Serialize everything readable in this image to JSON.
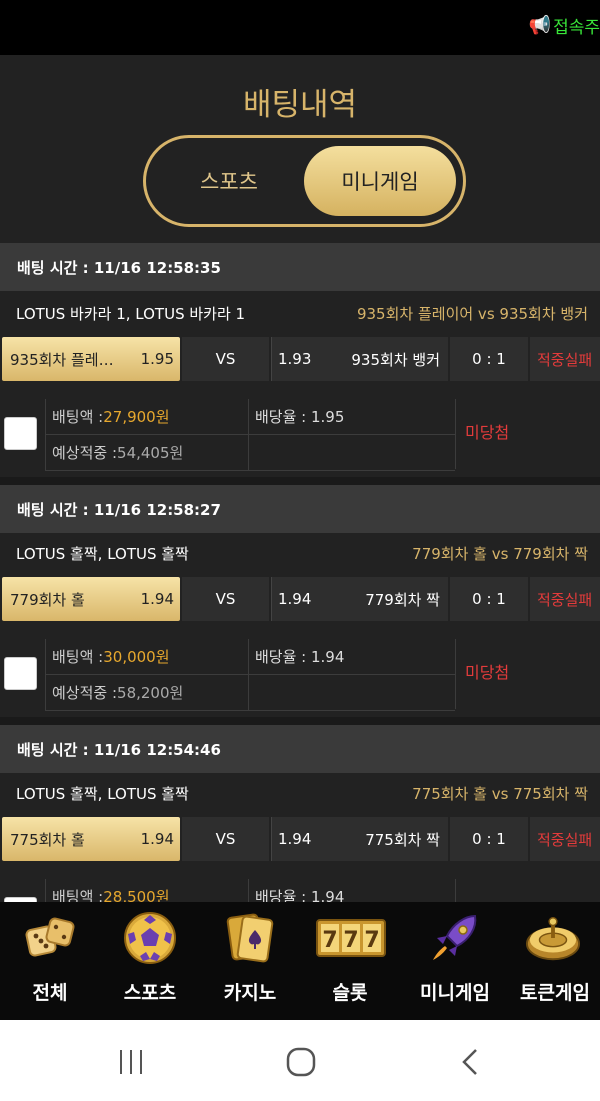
{
  "marquee": {
    "text": "접속주",
    "icon": "megaphone-icon"
  },
  "header": {
    "title": "배팅내역"
  },
  "tabs": [
    {
      "label": "스포츠",
      "active": false
    },
    {
      "label": "미니게임",
      "active": true
    }
  ],
  "bets": [
    {
      "time_label": "배팅 시간 : 11/16 12:58:35",
      "game_name": "LOTUS 바카라 1, LOTUS 바카라 1",
      "matchup": "935회차 플레이어  vs  935회차 뱅커",
      "home_label": "935회차 플레이어",
      "home_odds": "1.95",
      "vs": "VS",
      "away_odds": "1.93",
      "away_label": "935회차 뱅커",
      "score": "0 : 1",
      "result": "적중실패",
      "bet_amount_label": "배팅액 : ",
      "bet_amount": "27,900원",
      "expected_label": "예상적중 : ",
      "expected": "54,405원",
      "odds_label": "배당율 : 1.95",
      "status": "미당첨"
    },
    {
      "time_label": "배팅 시간 : 11/16 12:58:27",
      "game_name": "LOTUS 홀짝, LOTUS 홀짝",
      "matchup": "779회차 홀  vs  779회차 짝",
      "home_label": "779회차 홀",
      "home_odds": "1.94",
      "vs": "VS",
      "away_odds": "1.94",
      "away_label": "779회차 짝",
      "score": "0 : 1",
      "result": "적중실패",
      "bet_amount_label": "배팅액 : ",
      "bet_amount": "30,000원",
      "expected_label": "예상적중 : ",
      "expected": "58,200원",
      "odds_label": "배당율 : 1.94",
      "status": "미당첨"
    },
    {
      "time_label": "배팅 시간 : 11/16 12:54:46",
      "game_name": "LOTUS 홀짝, LOTUS 홀짝",
      "matchup": "775회차 홀  vs  775회차 짝",
      "home_label": "775회차 홀",
      "home_odds": "1.94",
      "vs": "VS",
      "away_odds": "1.94",
      "away_label": "775회차 짝",
      "score": "0 : 1",
      "result": "적중실패",
      "bet_amount_label": "배팅액 : ",
      "bet_amount": "28,500원",
      "odds_label": "배당율 : 1.94"
    }
  ],
  "bottom_nav": [
    {
      "label": "전체",
      "icon": "dice-icon"
    },
    {
      "label": "스포츠",
      "icon": "soccer-ball-icon"
    },
    {
      "label": "카지노",
      "icon": "cards-icon"
    },
    {
      "label": "슬롯",
      "icon": "slot-777-icon"
    },
    {
      "label": "미니게임",
      "icon": "rocket-icon"
    },
    {
      "label": "토큰게임",
      "icon": "roulette-icon"
    }
  ],
  "colors": {
    "gold": "#d7b46a",
    "loss_red": "#e23b3b",
    "amount_orange": "#e7a82e"
  }
}
